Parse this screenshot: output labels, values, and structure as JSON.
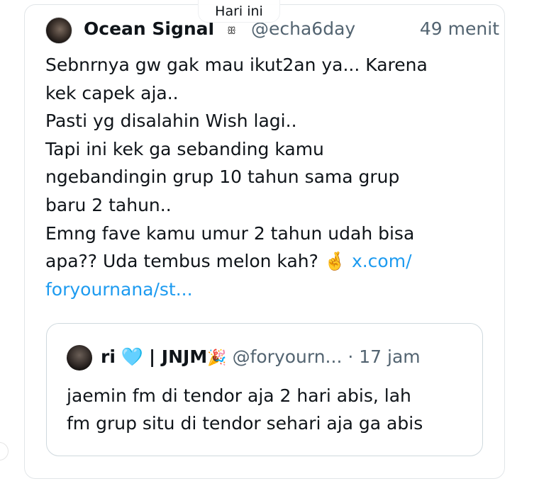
{
  "date_label": "Hari ini",
  "tweet": {
    "author_name": "Ocean Signal",
    "author_badge": "ꕥ",
    "author_handle": "@echa6day",
    "time": "49 menit",
    "lines": [
      "Sebnrnya gw gak mau ikut2an ya... Karena",
      "kek capek aja..",
      "Pasti yg disalahin Wish lagi..",
      "Tapi ini kek ga sebanding kamu",
      "ngebandingin grup 10 tahun sama grup",
      "baru 2 tahun..",
      "Emng fave kamu umur 2 tahun udah bisa"
    ],
    "last_line_text": "apa?? Uda tembus melon kah?",
    "last_line_emoji": "🤞",
    "link_part1": "x.com/",
    "link_part2": "foryournana/st..."
  },
  "quoted_tweet": {
    "name": "ri",
    "heart": "🩵",
    "group": "| JNJM",
    "party": "🎉",
    "handle": "@foryourn...",
    "separator": "·",
    "time": "17 jam",
    "lines": [
      "jaemin fm di tendor aja 2 hari abis, lah",
      "fm grup situ di tendor sehari aja ga abis"
    ]
  }
}
